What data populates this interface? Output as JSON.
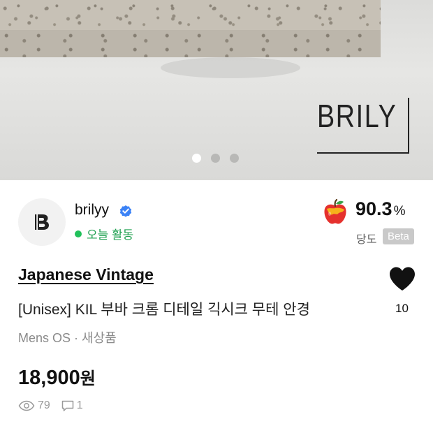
{
  "hero": {
    "brand_text": "BRILY",
    "carousel": {
      "count": 3,
      "active_index": 0
    }
  },
  "seller": {
    "avatar_letter": "B",
    "name": "brilyy",
    "verified": true,
    "status": "오늘 활동",
    "status_color": "#21c15b"
  },
  "sweetness": {
    "value": "90.3",
    "unit": "%",
    "label": "당도",
    "badge": "Beta"
  },
  "product": {
    "shop_name": "Japanese Vintage",
    "title": "[Unisex] KIL 부바 크롬 디테일 긱시크 무테 안경",
    "meta": "Mens OS · 새상품",
    "price": "18,900",
    "price_unit": "원",
    "likes": "10"
  },
  "stats": {
    "views": "79",
    "comments": "1"
  },
  "icons": [
    "verified-icon",
    "apple-icon",
    "heart-icon",
    "eye-icon",
    "comment-icon"
  ]
}
